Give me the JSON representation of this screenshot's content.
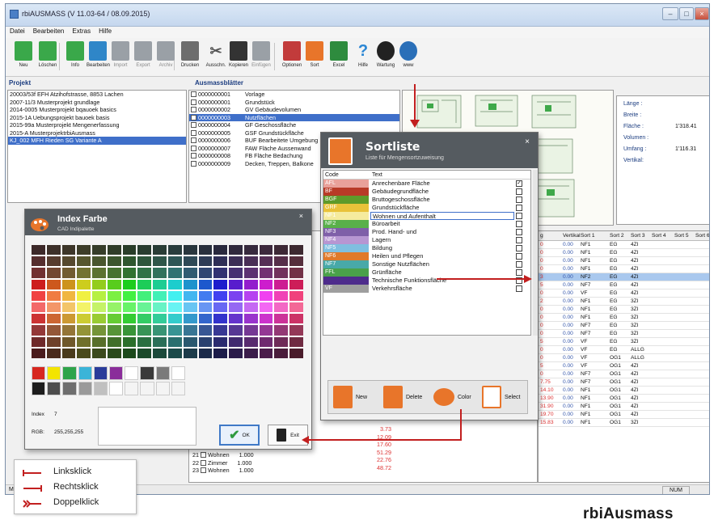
{
  "window": {
    "title": "rbiAUSMASS (V 11.03-64 / 08.09.2015)"
  },
  "menu": [
    "Datei",
    "Bearbeiten",
    "Extras",
    "Hilfe"
  ],
  "toolbar": [
    {
      "label": "Neu",
      "icon": "new-icon",
      "color": "#3aa84a",
      "disabled": false
    },
    {
      "label": "Löschen",
      "icon": "delete-icon",
      "color": "#3aa84a",
      "disabled": false
    },
    {
      "label": "Info",
      "icon": "info-icon",
      "color": "#3aa84a",
      "disabled": false
    },
    {
      "label": "Bearbeiten",
      "icon": "edit-icon",
      "color": "#2f86c8",
      "disabled": false
    },
    {
      "label": "Import",
      "icon": "import-icon",
      "color": "#9aa0a6",
      "disabled": true
    },
    {
      "label": "Export",
      "icon": "export-icon",
      "color": "#9aa0a6",
      "disabled": true
    },
    {
      "label": "Archiv",
      "icon": "archive-icon",
      "color": "#9aa0a6",
      "disabled": true
    },
    {
      "label": "Drucken",
      "icon": "print-icon",
      "color": "#6d6d6d",
      "disabled": false
    },
    {
      "label": "Ausschn.",
      "icon": "cut-icon",
      "color": "#555555",
      "disabled": false
    },
    {
      "label": "Kopieren",
      "icon": "copy-icon",
      "color": "#333333",
      "disabled": false
    },
    {
      "label": "Einfügen",
      "icon": "paste-icon",
      "color": "#9aa0a6",
      "disabled": true
    },
    {
      "label": "Optionen",
      "icon": "options-icon",
      "color": "#c23b3b",
      "disabled": false
    },
    {
      "label": "Sort",
      "icon": "sort-icon",
      "color": "#e8752a",
      "disabled": false
    },
    {
      "label": "Excel",
      "icon": "excel-icon",
      "color": "#2e8b3e",
      "disabled": false
    },
    {
      "label": "Hilfe",
      "icon": "help-icon",
      "color": "#2a86d4",
      "disabled": false
    },
    {
      "label": "Wartung",
      "icon": "maintenance-icon",
      "color": "#222222",
      "disabled": false
    },
    {
      "label": "www",
      "icon": "globe-icon",
      "color": "#2a6fb8",
      "disabled": false
    }
  ],
  "projekt": {
    "header": "Projekt",
    "items": [
      "20003/53f EFH Atzihofstrasse, 8853 Lachen",
      "2007-11/3 Musterprojekt grundlage",
      "2014-0005 Musterprojekt bqauoek basics",
      "2015-1A  Uebungsprojekt bauoek basis",
      "2015-99a Musterprojekt Mengenerfassung",
      "2015-A   MusterprojektrbiAusmass",
      "KJ_002   MFH Rieden SG Variante A"
    ],
    "selected": 6
  },
  "ausmass": {
    "header": "Ausmassblätter",
    "items": [
      {
        "code": "0000000001",
        "name": "Vorlage"
      },
      {
        "code": "0000000001",
        "name": "Grundstück"
      },
      {
        "code": "0000000002",
        "name": "GV Gebäudevolumen"
      },
      {
        "code": "0000000003",
        "name": "Nutzflächen"
      },
      {
        "code": "0000000004",
        "name": "GF Geschossfläche"
      },
      {
        "code": "0000000005",
        "name": "GSF Grundstückfläche"
      },
      {
        "code": "0000000006",
        "name": "BUF Bearbeitete Umgebung"
      },
      {
        "code": "0000000007",
        "name": "FAW Fläche Aussenwand"
      },
      {
        "code": "0000000008",
        "name": "FB Fläche Bedachung"
      },
      {
        "code": "0000000009",
        "name": "Decken, Treppen, Balkone"
      }
    ],
    "selected": 3
  },
  "props": {
    "laenge": "Länge :",
    "breite": "Breite :",
    "flaeche": "Fläche :",
    "flaeche_val": "1'318.41",
    "volumen": "Volumen :",
    "umfang": "Umfang :",
    "umfang_val": "1'116.31",
    "vertikal": "Vertikal:"
  },
  "grid": {
    "headers": [
      "g",
      "Vertikal",
      "Sort 1",
      "Sort 2",
      "Sort 3",
      "Sort 4",
      "Sort 5",
      "Sort 6"
    ],
    "rows": [
      [
        "0",
        "0.00",
        "NF1",
        "EG",
        "4ZI"
      ],
      [
        "0",
        "0.00",
        "NF1",
        "EG",
        "4ZI"
      ],
      [
        "0",
        "0.00",
        "NF1",
        "EG",
        "4ZI"
      ],
      [
        "0",
        "0.00",
        "NF1",
        "EG",
        "4ZI"
      ],
      [
        "3",
        "0.00",
        "NF2",
        "EG",
        "4ZI"
      ],
      [
        "5",
        "0.00",
        "NF7",
        "EG",
        "4ZI"
      ],
      [
        "0",
        "0.00",
        "VF",
        "EG",
        "4ZI"
      ],
      [
        "2",
        "0.00",
        "NF1",
        "EG",
        "3ZI"
      ],
      [
        "0",
        "0.00",
        "NF1",
        "EG",
        "3ZI"
      ],
      [
        "0",
        "0.00",
        "NF1",
        "EG",
        "3ZI"
      ],
      [
        "0",
        "0.00",
        "NF7",
        "EG",
        "3ZI"
      ],
      [
        "0",
        "0.00",
        "NF7",
        "EG",
        "3ZI"
      ],
      [
        "5",
        "0.00",
        "VF",
        "EG",
        "3ZI"
      ],
      [
        "0",
        "0.00",
        "VF",
        "EG",
        "ALLG"
      ],
      [
        "0",
        "0.00",
        "VF",
        "OG1",
        "ALLG"
      ],
      [
        "5",
        "0.00",
        "VF",
        "OG1",
        "4ZI"
      ],
      [
        "0",
        "0.00",
        "NF7",
        "OG1",
        "4ZI"
      ],
      [
        "7.75",
        "0.00",
        "NF7",
        "OG1",
        "4ZI"
      ],
      [
        "14.10",
        "0.00",
        "NF1",
        "OG1",
        "4ZI"
      ],
      [
        "13.90",
        "0.00",
        "NF1",
        "OG1",
        "4ZI"
      ],
      [
        "31.90",
        "0.00",
        "NF1",
        "OG1",
        "4ZI"
      ],
      [
        "19.70",
        "0.00",
        "NF1",
        "OG1",
        "4ZI"
      ],
      [
        "15.83",
        "0.00",
        "NF1",
        "OG1",
        "3ZI"
      ]
    ],
    "selected": 4
  },
  "bottom_rows": {
    "values": [
      "3.73",
      "12.09",
      "17.60",
      "51.29",
      "22.76",
      "48.72"
    ],
    "r1": {
      "no": "21",
      "name": "Wohnen",
      "val": "1.000"
    },
    "r2": {
      "no": "22",
      "name": "Zimmer",
      "val": "1.000"
    },
    "r3": {
      "no": "23",
      "name": "Wohnen",
      "val": "1.000"
    }
  },
  "status": {
    "num": "NUM",
    "left": "M"
  },
  "sortliste": {
    "title": "Sortliste",
    "subtitle": "Liste für Mengensortzuweisung",
    "col_code": "Code",
    "col_text": "Text",
    "items": [
      {
        "code": "AFL",
        "text": "Anrechenbare Fläche",
        "color": "#e9a19a",
        "checked": true
      },
      {
        "code": "BF",
        "text": "Gebäudegrundfläche",
        "color": "#b83a27",
        "checked": false
      },
      {
        "code": "BGF",
        "text": "Bruttogeschossfläche",
        "color": "#5e9a2a",
        "checked": false
      },
      {
        "code": "GRF",
        "text": "Grundstückfläche",
        "color": "#e9c23a",
        "checked": false
      },
      {
        "code": "NF1",
        "text": "Wohnen und Aufenthalt",
        "color": "#f5eb9e",
        "checked": false
      },
      {
        "code": "NF2",
        "text": "Büroarbeit",
        "color": "#59b04a",
        "checked": false
      },
      {
        "code": "NF3",
        "text": "Prod. Hand- und",
        "color": "#7f5fa8",
        "checked": false
      },
      {
        "code": "NF4",
        "text": "Lagern",
        "color": "#b796d2",
        "checked": false
      },
      {
        "code": "NF5",
        "text": "Bildung",
        "color": "#7fbfe0",
        "checked": false
      },
      {
        "code": "NF6",
        "text": "Heilen und Pflegen",
        "color": "#e07a2a",
        "checked": false
      },
      {
        "code": "NF7",
        "text": "Sonstige Nutzflächen",
        "color": "#48a9a8",
        "checked": false
      },
      {
        "code": "FFL",
        "text": "Grünfläche",
        "color": "#4aa14a",
        "checked": false
      },
      {
        "code": "",
        "text": "Technische Funktionsfläche",
        "color": "#4e2c8c",
        "checked": false
      },
      {
        "code": "VF",
        "text": "Verkehrsfläche",
        "color": "#9e9e9e",
        "checked": false
      }
    ],
    "buttons": [
      {
        "label": "New",
        "icon": "new-doc-icon"
      },
      {
        "label": "Delete",
        "icon": "delete-doc-icon"
      },
      {
        "label": "Color",
        "icon": "palette-icon"
      },
      {
        "label": "Select",
        "icon": "book-icon"
      }
    ]
  },
  "farbe": {
    "title": "Index Farbe",
    "subtitle": "CAD Indipalette",
    "index_label": "Index",
    "index_val": "7",
    "rgb_label": "RGB:",
    "rgb_val": "255,255,255",
    "ok": "OK",
    "exit": "Exit",
    "extra_colors": [
      "#d7271f",
      "#f3e400",
      "#2ea44a",
      "#3bb4d8",
      "#2a3c9a",
      "#8a2d9a",
      "#ffffff",
      "#3a3a3a",
      "#7a7a7a",
      "#ffffff",
      "#1d1d1d",
      "#4d4d4d",
      "#6e6e6e",
      "#9a9a9a",
      "#c0c0c0",
      "#ffffff",
      "#f4f4f4",
      "#f4f4f4",
      "#f4f4f4",
      "#f4f4f4"
    ]
  },
  "legend": {
    "l1": "Linksklick",
    "l2": "Rechtsklick",
    "l3": "Doppelklick",
    "color": "#c21f1f"
  },
  "brand": "rbiAusmass"
}
